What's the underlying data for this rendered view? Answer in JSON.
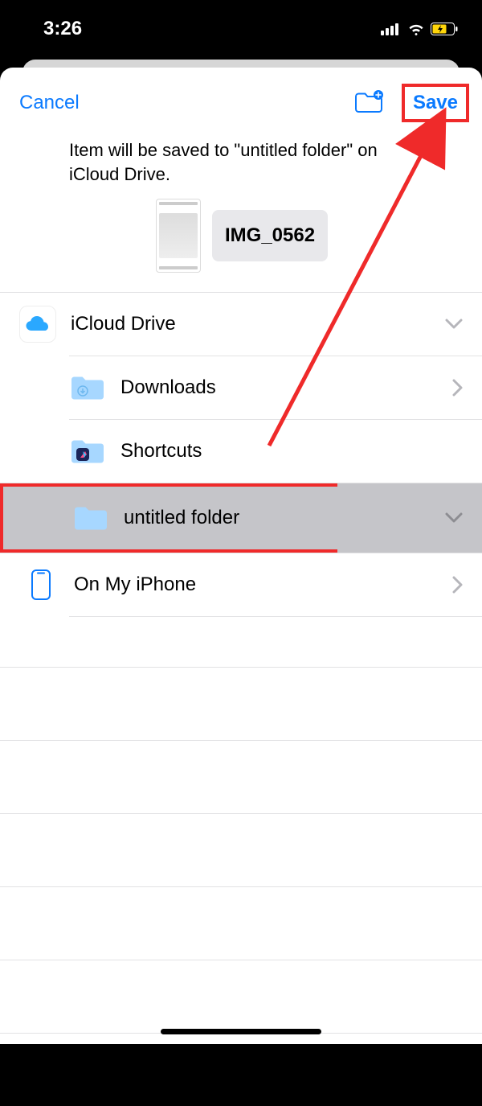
{
  "statusbar": {
    "time": "3:26"
  },
  "navbar": {
    "cancel": "Cancel",
    "save": "Save"
  },
  "description": "Item will be saved to \"untitled folder\" on iCloud Drive.",
  "filename": "IMG_0562",
  "locations": {
    "icloud": "iCloud Drive",
    "downloads": "Downloads",
    "shortcuts": "Shortcuts",
    "untitled": "untitled folder",
    "onmyiphone": "On My iPhone"
  }
}
